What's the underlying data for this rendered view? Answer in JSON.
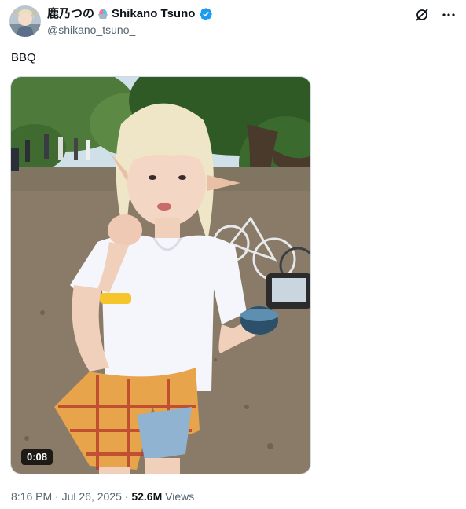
{
  "author": {
    "display_name_part1": "鹿乃つの",
    "display_name_part2": "Shikano Tsuno",
    "handle": "@shikano_tsuno_",
    "verified": true,
    "name_emoji": "shaved-ice-emoji"
  },
  "actions": {
    "grok_icon": "grok-icon",
    "more_icon": "more-dots-icon"
  },
  "tweet": {
    "text": "BBQ"
  },
  "media": {
    "type": "video",
    "duration": "0:08"
  },
  "meta": {
    "time": "8:16 PM",
    "separator": "·",
    "date": "Jul 26, 2025",
    "views_count": "52.6M",
    "views_label": "Views"
  },
  "colors": {
    "verified_blue": "#1d9bf0",
    "secondary_text": "#536471",
    "primary_text": "#0f1419"
  }
}
